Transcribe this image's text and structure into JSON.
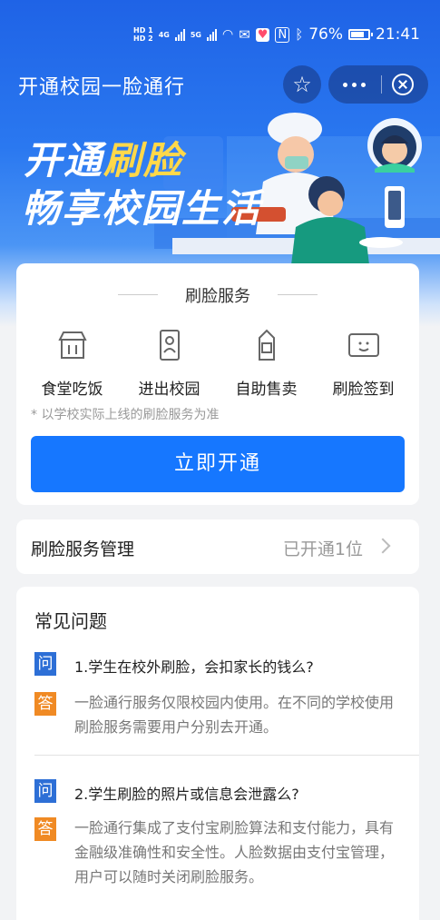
{
  "status_bar": {
    "hd1": "HD 1",
    "hd2": "HD 2",
    "net1": "4G",
    "net2": "5G",
    "battery": "76%",
    "time": "21:41"
  },
  "nav": {
    "title": "开通校园一脸通行"
  },
  "banner": {
    "line1_prefix": "开通",
    "line1_highlight": "刷脸",
    "line2": "畅享校园生活"
  },
  "service": {
    "title": "刷脸服务",
    "items": [
      {
        "label": "食堂吃饭",
        "icon": "canteen-icon"
      },
      {
        "label": "进出校园",
        "icon": "campus-gate-icon"
      },
      {
        "label": "自助售卖",
        "icon": "vending-icon"
      },
      {
        "label": "刷脸签到",
        "icon": "face-checkin-icon"
      }
    ],
    "note": "* 以学校实际上线的刷脸服务为准",
    "button": "立即开通"
  },
  "manage": {
    "label": "刷脸服务管理",
    "value": "已开通1位"
  },
  "faq": {
    "title": "常见问题",
    "q_badge": "问",
    "a_badge": "答",
    "items": [
      {
        "q": "1.学生在校外刷脸，会扣家长的钱么?",
        "a": "一脸通行服务仅限校园内使用。在不同的学校使用刷脸服务需要用户分别去开通。"
      },
      {
        "q": "2.学生刷脸的照片或信息会泄露么?",
        "a": "一脸通行集成了支付宝刷脸算法和支付能力，具有金融级准确性和安全性。人脸数据由支付宝管理，用户可以随时关闭刷脸服务。"
      }
    ]
  },
  "colors": {
    "primary": "#1677ff",
    "question": "#2d6fd6",
    "answer": "#f08a24",
    "highlight": "#ffd84a"
  }
}
